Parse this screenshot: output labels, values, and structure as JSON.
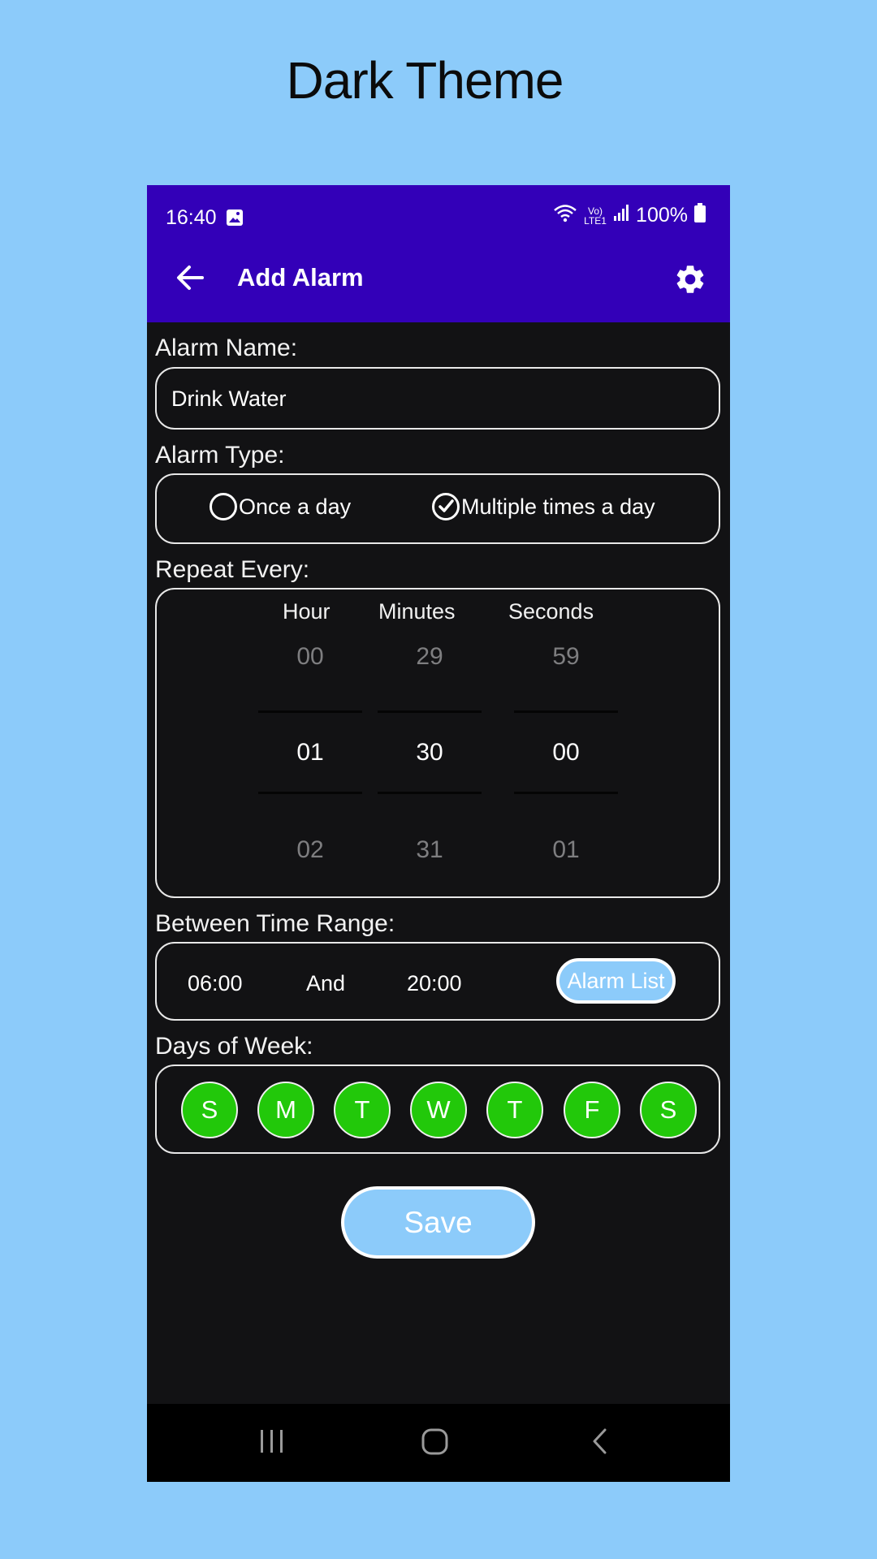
{
  "banner": {
    "title": "Dark Theme"
  },
  "status_bar": {
    "time": "16:40",
    "battery": "100%",
    "network": "Vo) LTE1"
  },
  "app_bar": {
    "title": "Add Alarm"
  },
  "alarm_name": {
    "label": "Alarm Name:",
    "value": "Drink Water"
  },
  "alarm_type": {
    "label": "Alarm Type:",
    "options": [
      {
        "label": "Once a day",
        "selected": false
      },
      {
        "label": "Multiple times a day",
        "selected": true
      }
    ]
  },
  "repeat_every": {
    "label": "Repeat Every:",
    "columns": [
      {
        "header": "Hour",
        "prev": "00",
        "value": "01",
        "next": "02"
      },
      {
        "header": "Minutes",
        "prev": "29",
        "value": "30",
        "next": "31"
      },
      {
        "header": "Seconds",
        "prev": "59",
        "value": "00",
        "next": "01"
      }
    ]
  },
  "time_range": {
    "label": "Between Time Range:",
    "start": "06:00",
    "conjunction": "And",
    "end": "20:00",
    "alarm_list_label": "Alarm List"
  },
  "days_of_week": {
    "label": "Days of Week:",
    "days": [
      "S",
      "M",
      "T",
      "W",
      "T",
      "F",
      "S"
    ]
  },
  "save_label": "Save",
  "colors": {
    "background": "#8ccbfa",
    "app_bar": "#3300b8",
    "surface": "#121214",
    "day_selected": "#22c80a",
    "button": "#8ccbfa"
  }
}
